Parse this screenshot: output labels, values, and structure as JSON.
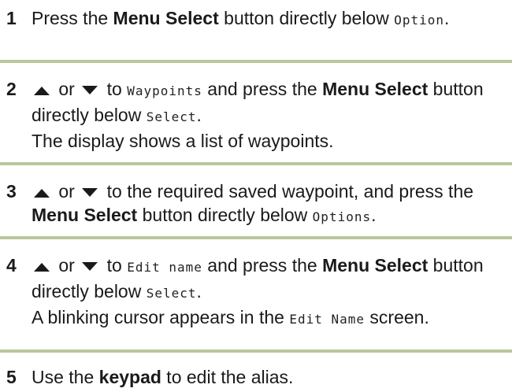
{
  "steps": [
    {
      "number": "1",
      "parts": [
        {
          "t": "Press the "
        },
        {
          "t": "Menu Select",
          "b": true
        },
        {
          "t": " button directly below "
        },
        {
          "t": "Option",
          "m": true
        },
        {
          "t": "."
        }
      ]
    },
    {
      "number": "2",
      "parts": [
        {
          "icon": "up-arrow-icon"
        },
        {
          "t": " or "
        },
        {
          "icon": "down-arrow-icon"
        },
        {
          "t": " to "
        },
        {
          "t": "Waypoints",
          "m": true
        },
        {
          "t": " and press the "
        },
        {
          "t": "Menu Select",
          "b": true
        },
        {
          "t": " button directly below "
        },
        {
          "t": "Select",
          "m": true
        },
        {
          "t": "."
        },
        {
          "br": true
        },
        {
          "t": "The display shows a list of waypoints."
        }
      ]
    },
    {
      "number": "3",
      "parts": [
        {
          "icon": "up-arrow-icon"
        },
        {
          "t": " or "
        },
        {
          "icon": "down-arrow-icon"
        },
        {
          "t": " to the required saved waypoint, and press the "
        },
        {
          "t": "Menu Select",
          "b": true
        },
        {
          "t": " button directly below "
        },
        {
          "t": "Options",
          "m": true
        },
        {
          "t": "."
        }
      ]
    },
    {
      "number": "4",
      "parts": [
        {
          "icon": "up-arrow-icon"
        },
        {
          "t": " or "
        },
        {
          "icon": "down-arrow-icon"
        },
        {
          "t": " to "
        },
        {
          "t": "Edit name",
          "m": true
        },
        {
          "t": " and press the "
        },
        {
          "t": "Menu Select",
          "b": true
        },
        {
          "t": " button directly below "
        },
        {
          "t": "Select",
          "m": true
        },
        {
          "t": "."
        },
        {
          "br": true
        },
        {
          "t": "A blinking cursor appears in the "
        },
        {
          "t": "Edit Name",
          "m": true
        },
        {
          "t": " screen."
        }
      ]
    },
    {
      "number": "5",
      "parts": [
        {
          "t": "Use the "
        },
        {
          "t": "keypad",
          "b": true
        },
        {
          "t": " to edit the alias."
        }
      ]
    }
  ],
  "colors": {
    "divider": "#b9c79a",
    "text": "#1a1a1a"
  }
}
